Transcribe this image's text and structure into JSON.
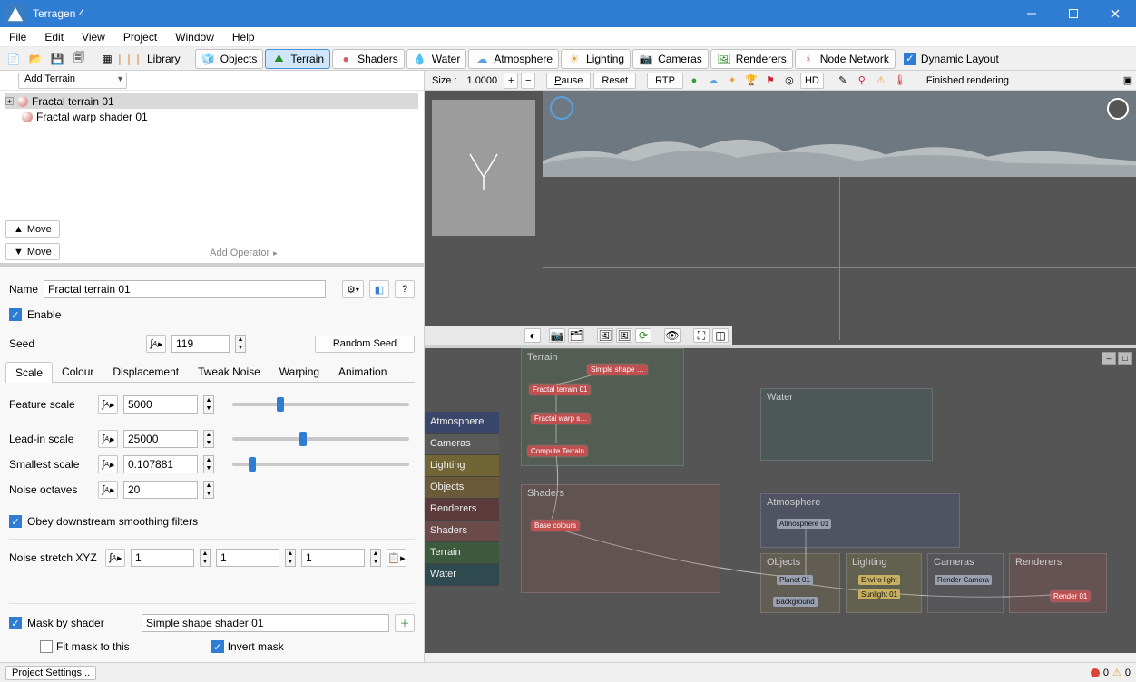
{
  "window": {
    "title": "Terragen 4"
  },
  "menubar": [
    "File",
    "Edit",
    "View",
    "Project",
    "Window",
    "Help"
  ],
  "toolbar": {
    "library": "Library",
    "tabs": [
      {
        "id": "objects",
        "label": "Objects"
      },
      {
        "id": "terrain",
        "label": "Terrain",
        "active": true
      },
      {
        "id": "shaders",
        "label": "Shaders"
      },
      {
        "id": "water",
        "label": "Water"
      },
      {
        "id": "atmosphere",
        "label": "Atmosphere"
      },
      {
        "id": "lighting",
        "label": "Lighting"
      },
      {
        "id": "cameras",
        "label": "Cameras"
      },
      {
        "id": "renderers",
        "label": "Renderers"
      }
    ],
    "node_network": "Node Network",
    "dynamic_layout": "Dynamic Layout"
  },
  "terrain_panel": {
    "add_terrain": "Add Terrain",
    "tree": [
      {
        "label": "Fractal terrain 01",
        "selected": true,
        "expandable": true
      },
      {
        "label": "Fractal warp shader 01",
        "selected": false,
        "expandable": false
      }
    ],
    "move_up": "Move",
    "move_down": "Move",
    "add_operator": "Add Operator"
  },
  "props": {
    "name_label": "Name",
    "name_value": "Fractal terrain 01",
    "enable_label": "Enable",
    "enable_checked": true,
    "seed_label": "Seed",
    "seed_value": "119",
    "random_seed": "Random Seed",
    "tabs": [
      "Scale",
      "Colour",
      "Displacement",
      "Tweak Noise",
      "Warping",
      "Animation"
    ],
    "active_tab": "Scale",
    "scale": {
      "feature": {
        "label": "Feature scale",
        "value": "5000",
        "slider": 0.25
      },
      "leadin": {
        "label": "Lead-in scale",
        "value": "25000",
        "slider": 0.38
      },
      "smallest": {
        "label": "Smallest scale",
        "value": "0.107881",
        "slider": 0.09
      },
      "octaves": {
        "label": "Noise octaves",
        "value": "20"
      },
      "obey": {
        "label": "Obey downstream smoothing filters",
        "checked": true
      },
      "stretch": {
        "label": "Noise stretch XYZ",
        "x": "1",
        "y": "1",
        "z": "1"
      }
    },
    "mask": {
      "mask_label": "Mask by shader",
      "mask_checked": true,
      "mask_value": "Simple shape shader 01",
      "fit_label": "Fit mask to this",
      "fit_checked": false,
      "invert_label": "Invert mask",
      "invert_checked": true
    }
  },
  "render_toolbar": {
    "size_label": "Size :",
    "size_value": "1.0000",
    "pause": "Pause",
    "reset": "Reset",
    "rtp": "RTP",
    "hd": "HD",
    "status": "Finished rendering"
  },
  "node_categories": [
    "Atmosphere",
    "Cameras",
    "Lighting",
    "Objects",
    "Renderers",
    "Shaders",
    "Terrain",
    "Water"
  ],
  "zones": {
    "terrain": "Terrain",
    "shaders": "Shaders",
    "water": "Water",
    "atmosphere": "Atmosphere",
    "objects": "Objects",
    "lighting": "Lighting",
    "cameras": "Cameras",
    "renderers": "Renderers"
  },
  "nodes": {
    "simple_shape": "Simple shape …",
    "fractal_terrain": "Fractal terrain 01",
    "fractal_warp": "Fractal warp s…",
    "compute_terrain": "Compute Terrain",
    "base_colours": "Base colours",
    "atmosphere01": "Atmosphere 01",
    "planet": "Planet 01",
    "background": "Background",
    "enviro": "Enviro light",
    "sunlight": "Sunlight 01",
    "render_cam": "Render Camera",
    "render01": "Render 01"
  },
  "statusbar": {
    "project_settings": "Project Settings...",
    "err": "0",
    "warn": "0"
  }
}
